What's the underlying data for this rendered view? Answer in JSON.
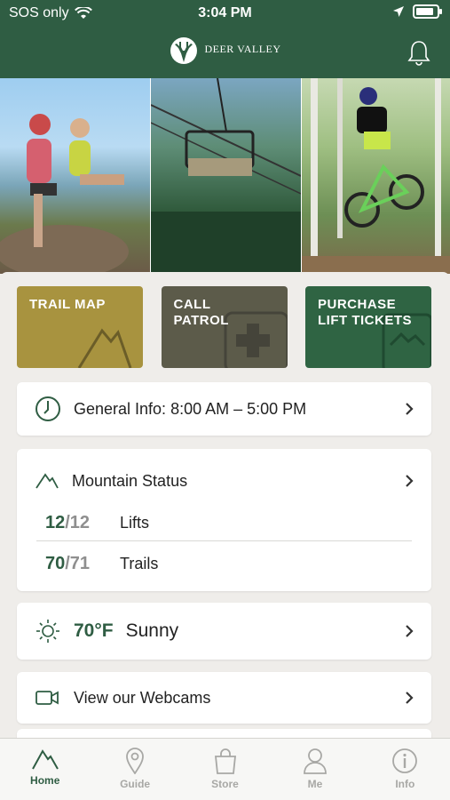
{
  "status_bar": {
    "carrier": "SOS only",
    "time": "3:04 PM",
    "battery_level": 0.85
  },
  "header": {
    "brand": "DEER VALLEY"
  },
  "tiles": [
    {
      "label": "TRAIL MAP",
      "color": "#a8933f"
    },
    {
      "label": "CALL\nPATROL",
      "color": "#5c5b4a"
    },
    {
      "label": "PURCHASE\nLIFT TICKETS",
      "color": "#2f6443"
    }
  ],
  "general_info": {
    "label": "General Info: 8:00 AM – 5:00 PM"
  },
  "mountain_status": {
    "title": "Mountain Status",
    "lifts": {
      "open": "12",
      "total": "/12",
      "label": "Lifts"
    },
    "trails": {
      "open": "70",
      "total": "/71",
      "label": "Trails"
    }
  },
  "weather": {
    "temp": "70°F",
    "condition": "Sunny"
  },
  "webcams": {
    "label": "View our Webcams"
  },
  "tabs": [
    {
      "label": "Home",
      "icon": "mountain-icon",
      "active": true
    },
    {
      "label": "Guide",
      "icon": "map-pin-icon",
      "active": false
    },
    {
      "label": "Store",
      "icon": "shopping-bag-icon",
      "active": false
    },
    {
      "label": "Me",
      "icon": "person-icon",
      "active": false
    },
    {
      "label": "Info",
      "icon": "info-icon",
      "active": false
    }
  ],
  "colors": {
    "brand_green": "#2f5d43",
    "tab_inactive": "#a8a8a5"
  }
}
